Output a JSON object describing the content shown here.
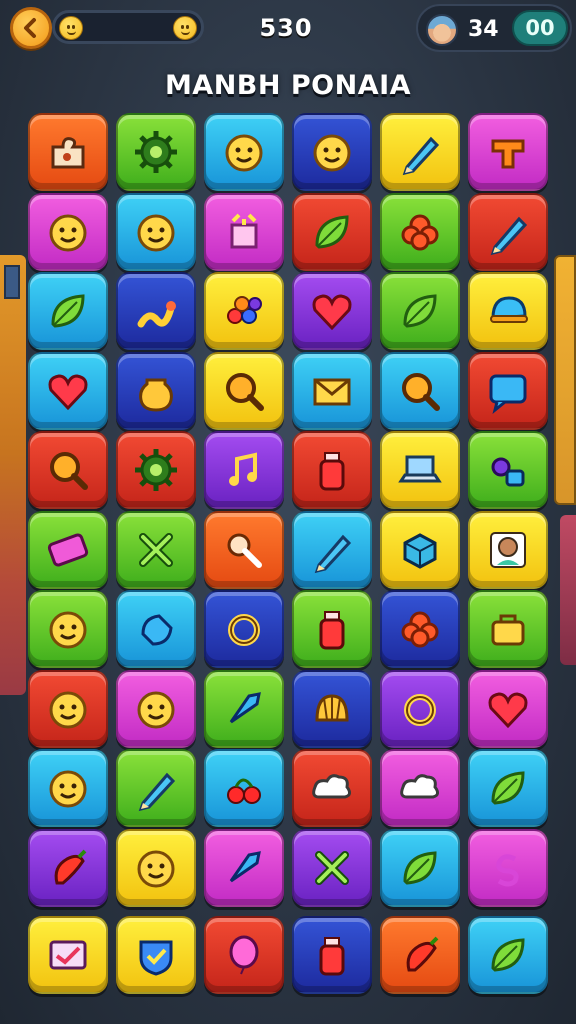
{
  "hud": {
    "back_icon": "chevron-left-icon",
    "score": "530",
    "coins": "34",
    "timer": "00"
  },
  "title": "MANBH PONAIA",
  "grid": {
    "rows": [
      [
        "c-orange:puzzle",
        "c-green:gear",
        "c-cyan:face",
        "c-navy:face",
        "c-yellow:pencil",
        "c-magenta:block"
      ],
      [
        "c-magenta:face",
        "c-cyan:face",
        "c-magenta:box",
        "c-red:leaf",
        "c-green:flower",
        "c-red:pencil"
      ],
      [
        "c-cyan:leaf",
        "c-navy:snake",
        "c-yellow:berries",
        "c-purple:heart",
        "c-green:leaf",
        "c-yellow:helmet"
      ],
      [
        "c-cyan:heart",
        "c-navy:jar",
        "c-yellow:magnifier",
        "c-cyan:envelope",
        "c-cyan:magnifier",
        "c-red:chat"
      ],
      [
        "c-red:magnifier",
        "c-red:gear",
        "c-purple:music",
        "c-red:bottle",
        "c-yellow:laptop",
        "c-green:paint"
      ],
      [
        "c-green:ticket",
        "c-green:cross",
        "c-orange:ladle",
        "c-cyan:pencil",
        "c-yellow:cube",
        "c-yellow:person"
      ],
      [
        "c-green:face",
        "c-cyan:ice",
        "c-navy:ring",
        "c-green:bottle",
        "c-navy:flower",
        "c-green:bag"
      ],
      [
        "c-red:face",
        "c-magenta:face",
        "c-green:rocket",
        "c-navy:shell",
        "c-purple:ring",
        "c-magenta:heart"
      ],
      [
        "c-cyan:face",
        "c-green:pencil",
        "c-cyan:cherries",
        "c-red:cloud",
        "c-magenta:cloud",
        "c-cyan:leaf"
      ],
      [
        "c-purple:pepper",
        "c-yellow:face",
        "c-magenta:rocket",
        "c-purple:cross",
        "c-cyan:leaf",
        "c-magenta:swirl"
      ],
      [
        "c-yellow:card",
        "c-yellow:shield",
        "c-red:balloon",
        "c-navy:bottle",
        "c-orange:pepper",
        "c-cyan:leaf"
      ]
    ]
  }
}
